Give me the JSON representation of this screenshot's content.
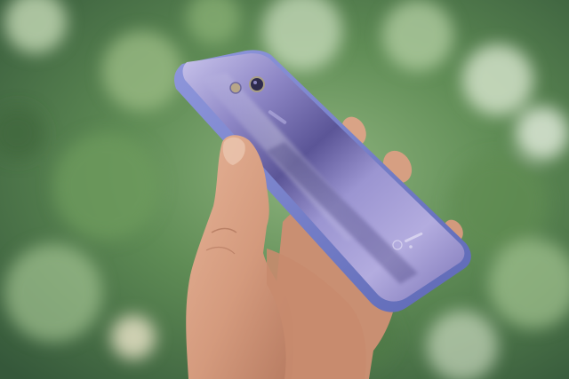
{
  "photo": {
    "subject": "hand-holding-smartphone",
    "colors": {
      "background_dark": "#3f6a3c",
      "background_mid": "#6f9a62",
      "background_light": "#b9d2aa",
      "phone_body": "#8d86c4",
      "phone_highlight": "#e3e0f6",
      "phone_shadow": "#4e4a86",
      "phone_frame": "#6f78c4",
      "skin": "#d8a184",
      "skin_shadow": "#b87a5e"
    }
  }
}
